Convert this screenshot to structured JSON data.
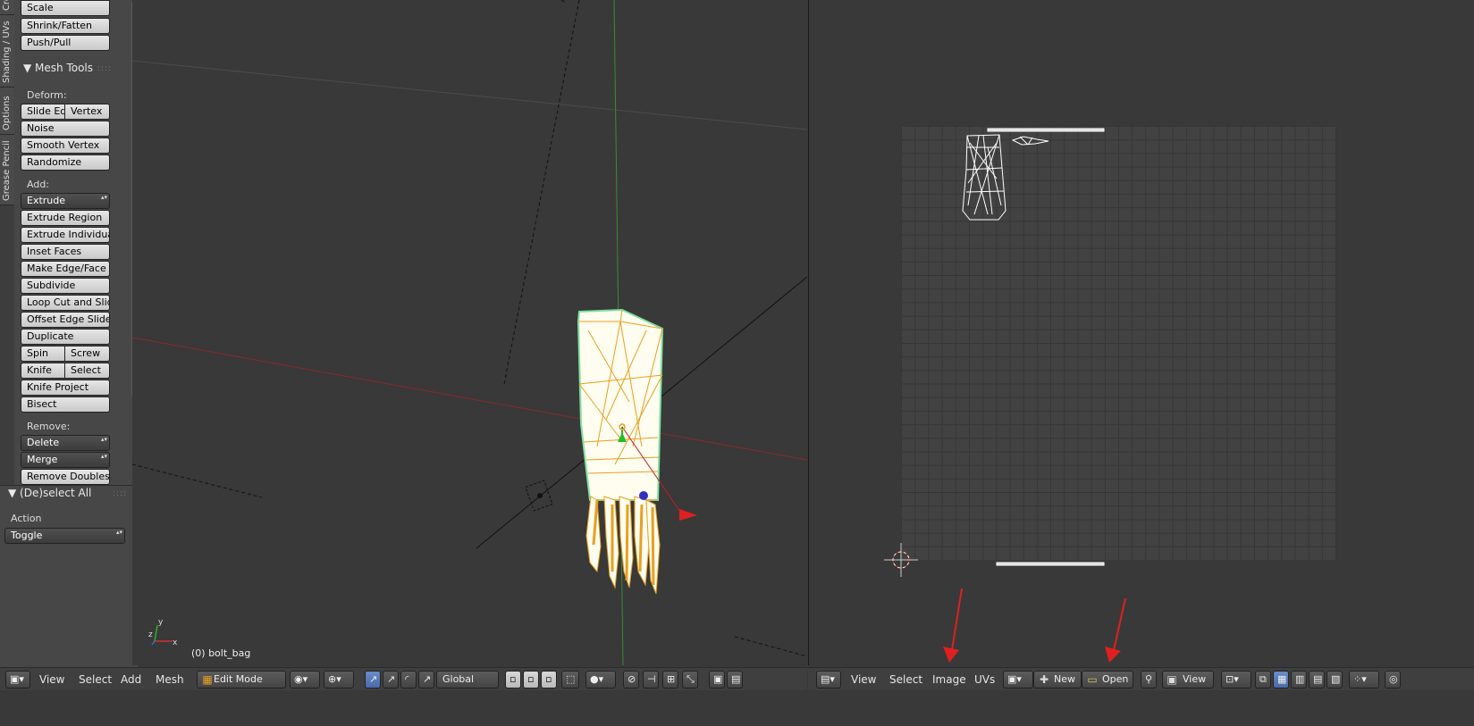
{
  "side_tabs": [
    "Cre",
    "Shading / UVs",
    "Options",
    "Grease Pencil"
  ],
  "tool_shelf": {
    "transform_buttons": [
      "Scale",
      "Shrink/Fatten",
      "Push/Pull"
    ],
    "mesh_tools_title": "Mesh Tools",
    "deform_label": "Deform:",
    "slide_edge": "Slide Ed",
    "vertex": "Vertex",
    "noise": "Noise",
    "smooth_vertex": "Smooth Vertex",
    "randomize": "Randomize",
    "add_label": "Add:",
    "extrude": "Extrude",
    "extrude_region": "Extrude Region",
    "extrude_individual": "Extrude Individual",
    "inset_faces": "Inset Faces",
    "make_edge_face": "Make Edge/Face",
    "subdivide": "Subdivide",
    "loop_cut": "Loop Cut and Slide",
    "offset_edge_slide": "Offset Edge Slide",
    "duplicate": "Duplicate",
    "spin": "Spin",
    "screw": "Screw",
    "knife": "Knife",
    "select": "Select",
    "knife_project": "Knife Project",
    "bisect": "Bisect",
    "remove_label": "Remove:",
    "delete": "Delete",
    "merge": "Merge",
    "remove_doubles": "Remove Doubles"
  },
  "operator_panel": {
    "title": "(De)select All",
    "action_label": "Action",
    "action_value": "Toggle"
  },
  "viewport": {
    "object_label": "(0) bolt_bag"
  },
  "header_3d": {
    "menus": [
      "View",
      "Select",
      "Add",
      "Mesh"
    ],
    "mode": "Edit Mode",
    "orientation": "Global"
  },
  "header_uv": {
    "menus": [
      "View",
      "Select",
      "Image",
      "UVs"
    ],
    "new_label": "New",
    "open_label": "Open",
    "view_label": "View"
  },
  "colors": {
    "background": "#393939",
    "panel": "#474747",
    "mesh_fill": "#fffdf0",
    "mesh_edge": "#e8a020",
    "selection_outline": "#7fe0a0",
    "annotation_arrow": "#e02020"
  },
  "icons": [
    "editor-type-icon",
    "snap-icon",
    "shading-icon",
    "manipulator-icon",
    "add-icon",
    "image-icon",
    "pin-icon",
    "render-icon"
  ]
}
